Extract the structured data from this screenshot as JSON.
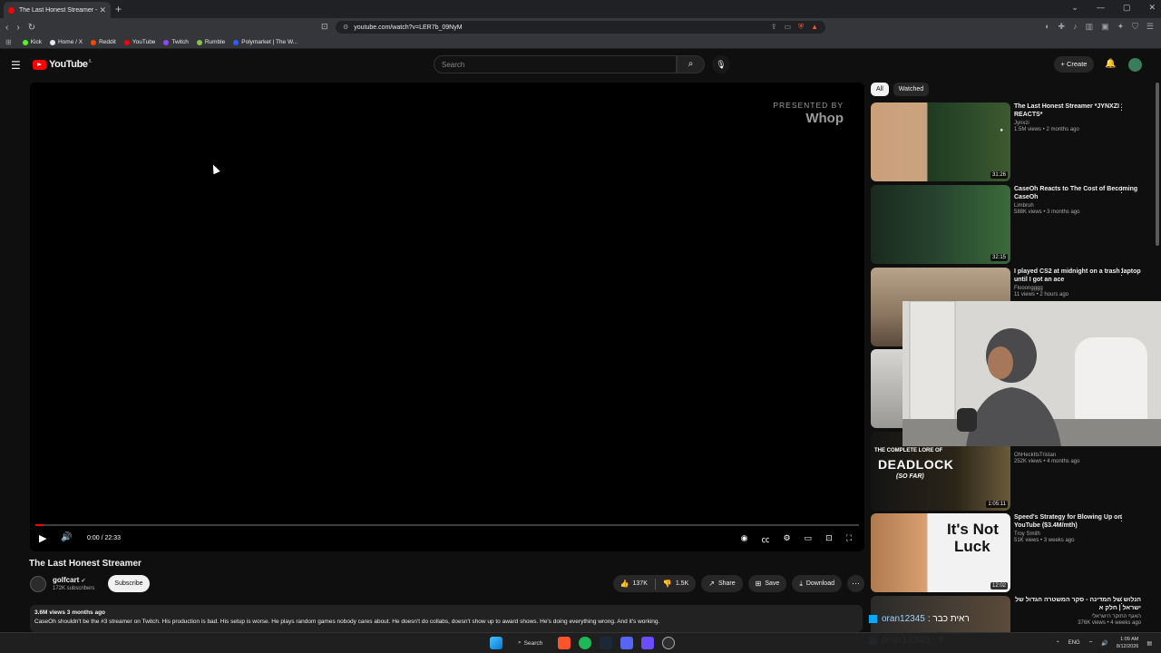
{
  "browser": {
    "tab_title": "The Last Honest Streamer - YouTube",
    "url": "youtube.com/watch?v=LER7b_09NyM",
    "bookmarks": [
      {
        "label": "Kick",
        "color": "#53fc18"
      },
      {
        "label": "Home / X",
        "color": "#e8eaed"
      },
      {
        "label": "Reddit",
        "color": "#ff4500"
      },
      {
        "label": "YouTube",
        "color": "#ff0000"
      },
      {
        "label": "Twitch",
        "color": "#9146ff"
      },
      {
        "label": "Rumble",
        "color": "#85c742"
      },
      {
        "label": "Polymarket | The W...",
        "color": "#2e5cff"
      }
    ]
  },
  "youtube": {
    "logo_text": "YouTube",
    "country_code": "IL",
    "search_placeholder": "Search",
    "create_label": "+ Create"
  },
  "player": {
    "sponsor_line1": "PRESENTED BY",
    "sponsor_line2": "Whop",
    "time": "0:00 / 22:33",
    "progress": 0.01
  },
  "video": {
    "title": "The Last Honest Streamer",
    "channel": "golfcart",
    "subscribers": "172K subscribers",
    "subscribe_label": "Subscribe",
    "likes": "137K",
    "dislikes": "1.5K",
    "share_label": "Share",
    "save_label": "Save",
    "download_label": "Download",
    "meta": "3.6M views  3 months ago",
    "description": "CaseOh shouldn't be the #3 streamer on Twitch. His production is bad. His setup is worse. He plays random games nobody cares about. He doesn't do collabs, doesn't show up to award shows. He's doing everything wrong. And it's working."
  },
  "chips": [
    "All",
    "Watched"
  ],
  "recommendations": [
    {
      "title": "The Last Honest Streamer *JYNXZI REACTS*",
      "channel": "Jynxzi",
      "meta": "1.5M views • 2 months ago",
      "duration": "31:26",
      "bg": "#2f4a2f"
    },
    {
      "title": "CaseOh Reacts to The Cost of Becoming CaseOh",
      "channel": "Limbruh",
      "meta": "588K views • 3 months ago",
      "duration": "32:15",
      "bg": "#1f3a2a"
    },
    {
      "title": "I played CS2 at midnight on a trash laptop until I got an ace",
      "channel": "Flooongggg",
      "meta": "11 views • 2 hours ago",
      "duration": "",
      "bg": "#8a7a6a"
    },
    {
      "title": "",
      "channel": "",
      "meta": "",
      "duration": "",
      "bg": "#bdbab4"
    },
    {
      "title": "",
      "channel": "OhHeckItsTristan",
      "meta": "252K views • 4 months ago",
      "duration": "1:05:11",
      "bg": "#1a1a1a",
      "thumb_text1": "THE COMPLETE LORE OF",
      "thumb_text2": "DEADLOCK",
      "thumb_text3": "(SO FAR)"
    },
    {
      "title": "Speed's Strategy for Blowing Up on YouTube ($3.4M/mth)",
      "channel": "Troy Smith",
      "meta": "51K views • 3 weeks ago",
      "duration": "12:02",
      "bg": "#e9e9e9",
      "thumb_text1": "It's Not",
      "thumb_text2": "Luck"
    },
    {
      "title": "הנלוש של המדינה - סקר המשטרה הגדול של ישראל | חלק א",
      "channel": "האגף החוקר הישראלי",
      "meta": "376K views • 4 weeks ago",
      "duration": "",
      "bg": "#3a3a3a"
    }
  ],
  "overlay": {
    "chat_user": "oran12345",
    "chat_text": ": ?",
    "chat_user_small": "oran12345",
    "chat_text_small": ": ראית כבר"
  },
  "taskbar": {
    "search_label": "Search",
    "lang": "ENG",
    "time": "1:09 AM",
    "date": "8/12/2026"
  }
}
